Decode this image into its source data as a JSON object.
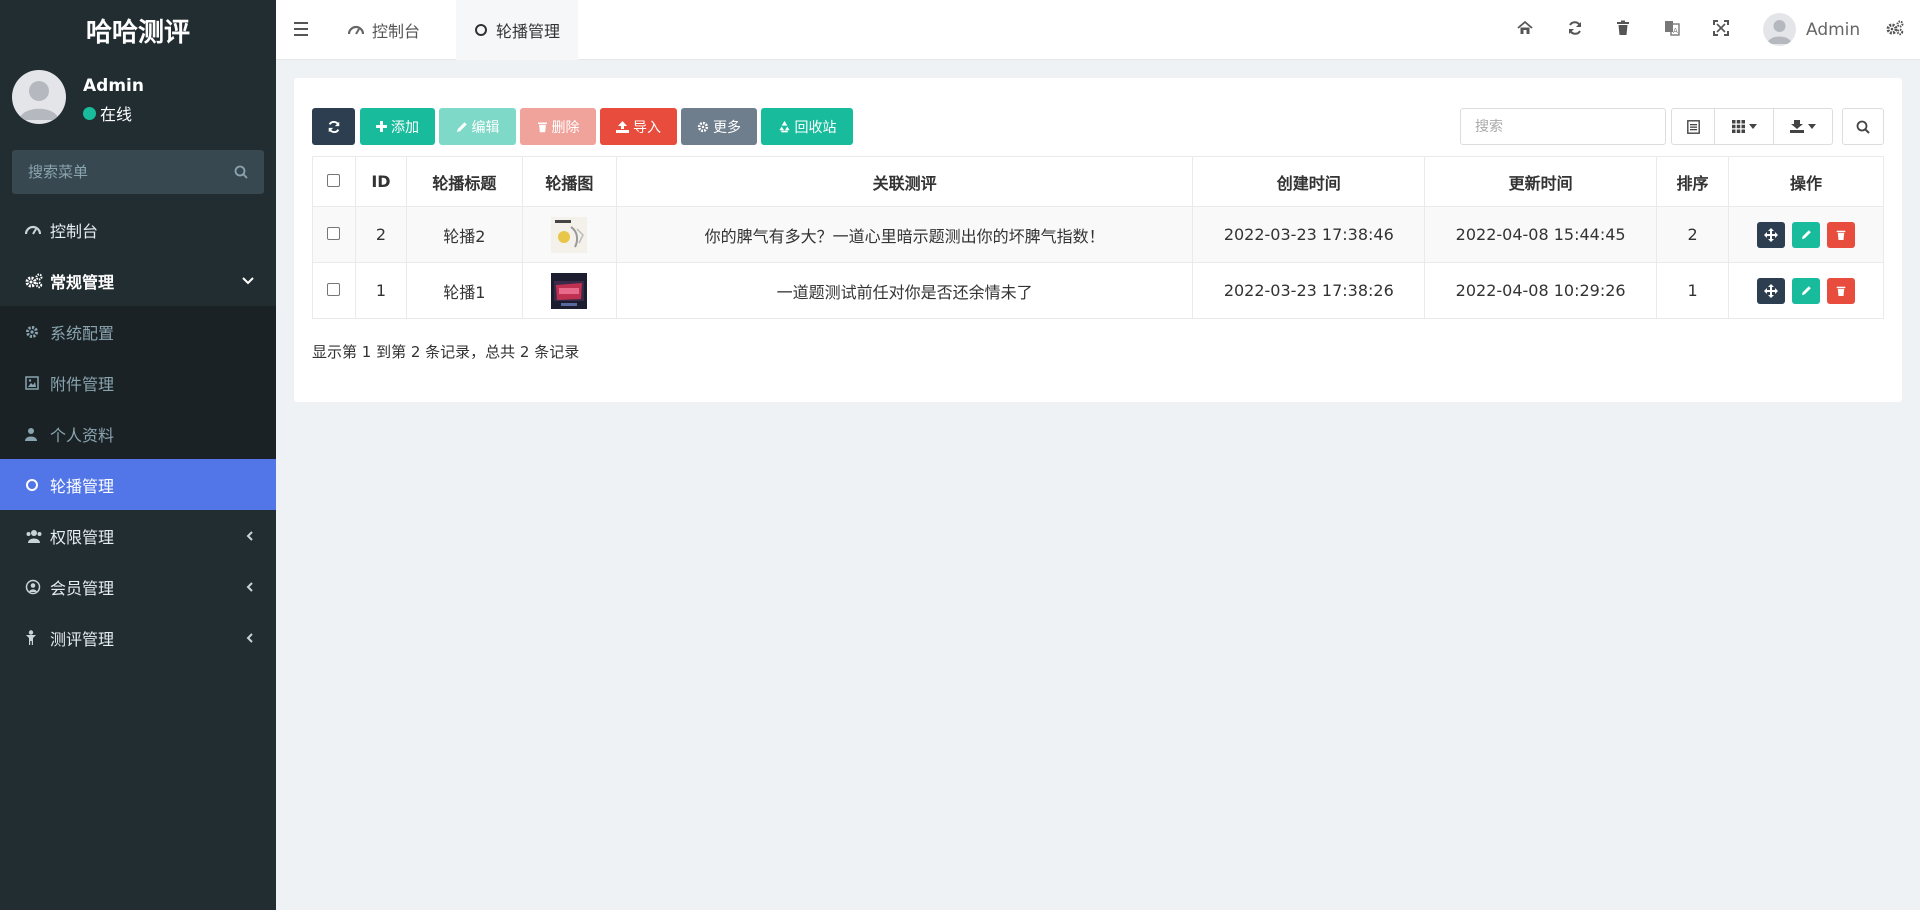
{
  "app": {
    "logo": "哈哈测评"
  },
  "user": {
    "name": "Admin",
    "status": "在线"
  },
  "sidebar": {
    "search_placeholder": "搜索菜单",
    "items": [
      {
        "label": "控制台",
        "icon": "dashboard-icon"
      },
      {
        "label": "常规管理",
        "icon": "cogs-icon",
        "expanded": true
      },
      {
        "label": "系统配置",
        "icon": "gear-icon"
      },
      {
        "label": "附件管理",
        "icon": "image-icon"
      },
      {
        "label": "个人资料",
        "icon": "user-icon"
      },
      {
        "label": "轮播管理",
        "icon": "circle-icon",
        "active": true
      },
      {
        "label": "权限管理",
        "icon": "group-icon"
      },
      {
        "label": "会员管理",
        "icon": "user-circle-icon"
      },
      {
        "label": "测评管理",
        "icon": "child-icon"
      }
    ]
  },
  "topbar": {
    "tabs": [
      {
        "label": "控制台",
        "icon": "dashboard-icon"
      },
      {
        "label": "轮播管理",
        "icon": "circle-icon",
        "active": true
      }
    ],
    "user_name": "Admin"
  },
  "toolbar": {
    "add": "添加",
    "edit": "编辑",
    "delete": "删除",
    "import": "导入",
    "more": "更多",
    "recycle": "回收站",
    "search_placeholder": "搜索"
  },
  "table": {
    "headers": [
      "ID",
      "轮播标题",
      "轮播图",
      "关联测评",
      "创建时间",
      "更新时间",
      "排序",
      "操作"
    ],
    "rows": [
      {
        "id": "2",
        "title": "轮播2",
        "test": "你的脾气有多大？一道心里暗示题测出你的坏脾气指数！",
        "created": "2022-03-23 17:38:46",
        "updated": "2022-04-08 15:44:45",
        "sort": "2"
      },
      {
        "id": "1",
        "title": "轮播1",
        "test": "一道题测试前任对你是否还余情未了",
        "created": "2022-03-23 17:38:26",
        "updated": "2022-04-08 10:29:26",
        "sort": "1"
      }
    ]
  },
  "pagination": {
    "info": "显示第 1 到第 2 条记录，总共 2 条记录"
  },
  "colors": {
    "sidebar": "#222d32",
    "active": "#5276e8",
    "green": "#18bc9c",
    "red": "#e74c3c",
    "dark": "#2c3e50"
  }
}
